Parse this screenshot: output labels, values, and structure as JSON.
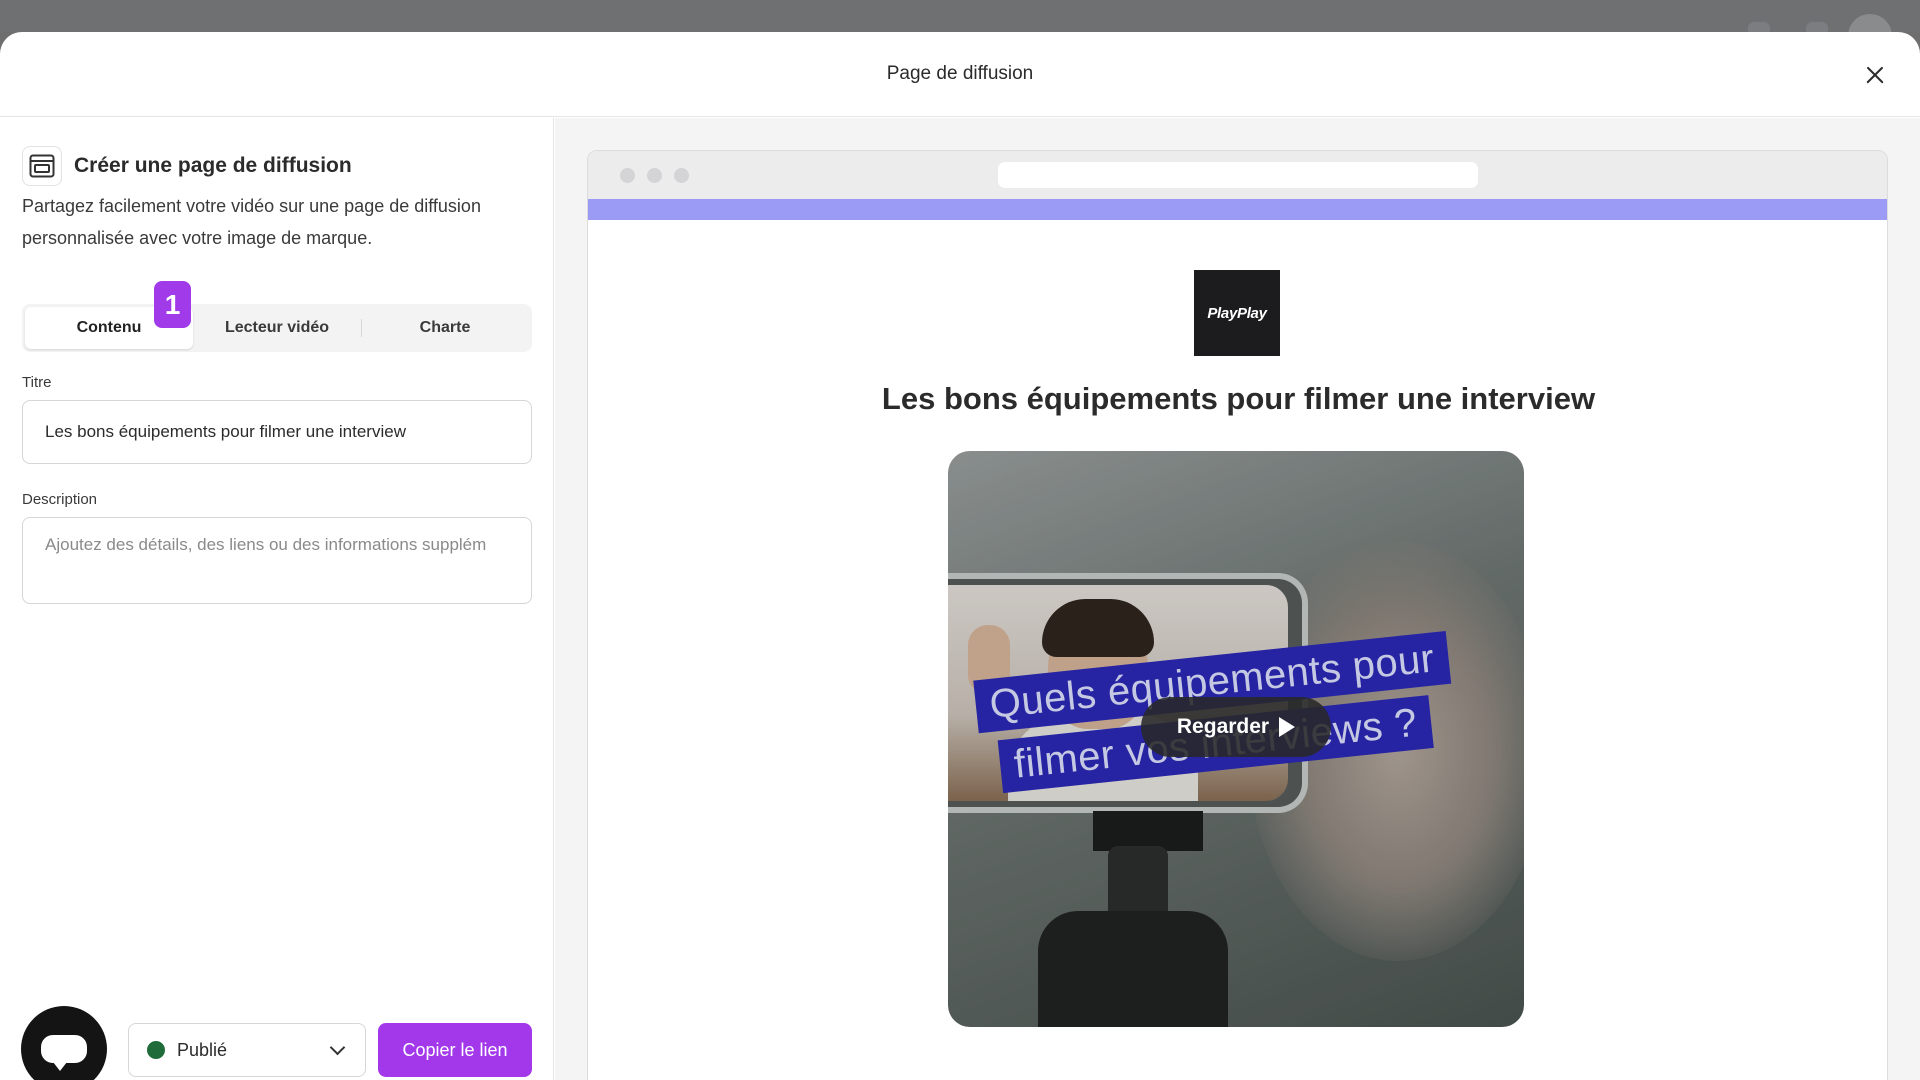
{
  "modal": {
    "title": "Page de diffusion"
  },
  "left_panel": {
    "heading": "Créer une page de diffusion",
    "description": "Partagez facilement votre vidéo sur une page de diffusion personnalisée avec votre image de marque.",
    "step_badge": "1",
    "tabs": [
      {
        "label": "Contenu",
        "active": true
      },
      {
        "label": "Lecteur vidéo",
        "active": false
      },
      {
        "label": "Charte",
        "active": false
      }
    ],
    "fields": {
      "title_label": "Titre",
      "title_value": "Les bons équipements pour filmer une interview",
      "description_label": "Description",
      "description_placeholder": "Ajoutez des détails, des liens ou des informations supplém"
    },
    "footer": {
      "status_label": "Publié",
      "status_color": "#1f6b3a",
      "copy_button_label": "Copier le lien",
      "accent_color": "#a238ea"
    }
  },
  "preview": {
    "brand_logo_text": "PlayPlay",
    "accent_strip_color": "#9b9af4",
    "page_title": "Les bons équipements pour filmer une interview",
    "video": {
      "caption_line_1": "Quels équipements pour",
      "caption_line_2": "filmer vos interviews ?",
      "play_label": "Regarder"
    }
  },
  "icons": {
    "close": "close-icon",
    "page": "broadcast-page-icon",
    "chat": "chat-icon",
    "play": "play-icon",
    "chevron": "chevron-down-icon"
  }
}
